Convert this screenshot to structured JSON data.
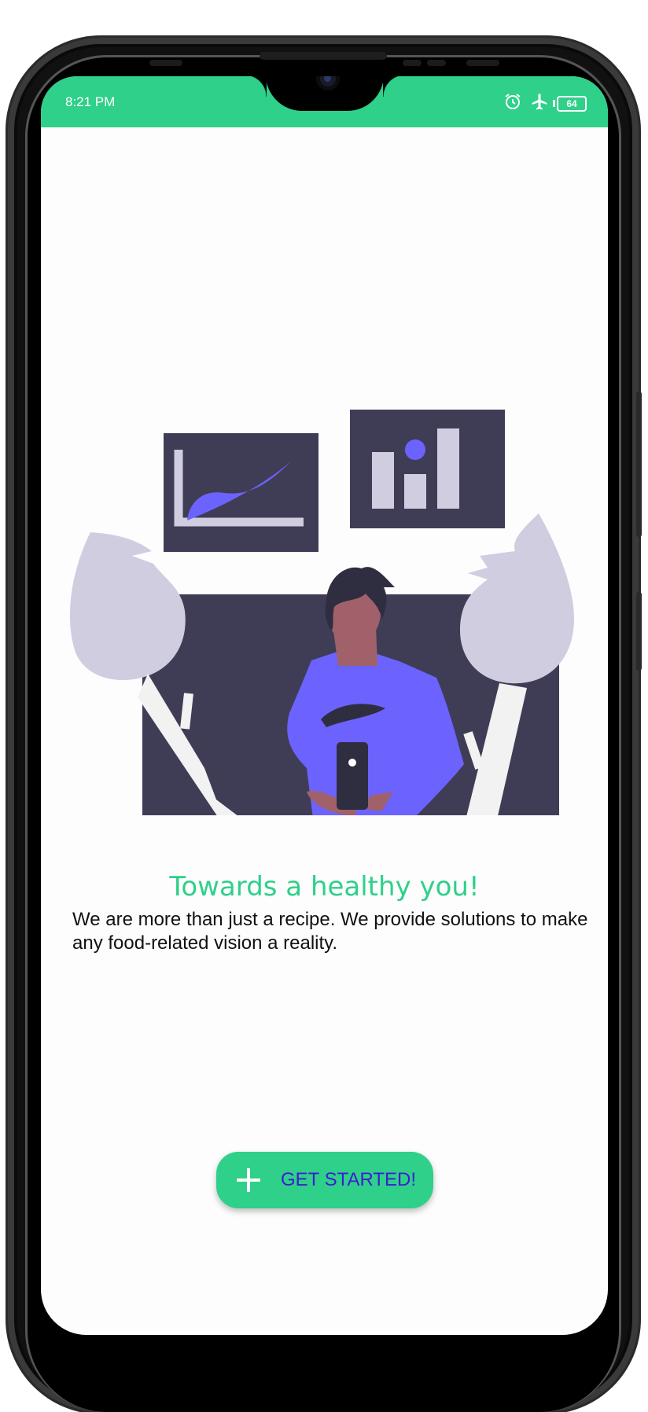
{
  "status_bar": {
    "time": "8:21 PM",
    "icons": [
      "alarm-icon",
      "airplane-icon",
      "battery-icon"
    ],
    "battery_level": "64"
  },
  "hero": {
    "illustration": "person-with-phone-charts-icon",
    "colors": {
      "accent": "#6c63ff",
      "dark": "#3f3d56",
      "light": "#d0cde1",
      "skin": "#a0616a"
    }
  },
  "onboarding": {
    "title": "Towards a healthy you!",
    "description": "We are more than just a recipe. We provide solutions to make any food-related vision a reality."
  },
  "cta": {
    "icon": "plus-icon",
    "label": "GET STARTED!"
  },
  "colors": {
    "brand": "#2fd08a",
    "button_text": "#3a1fd0"
  }
}
